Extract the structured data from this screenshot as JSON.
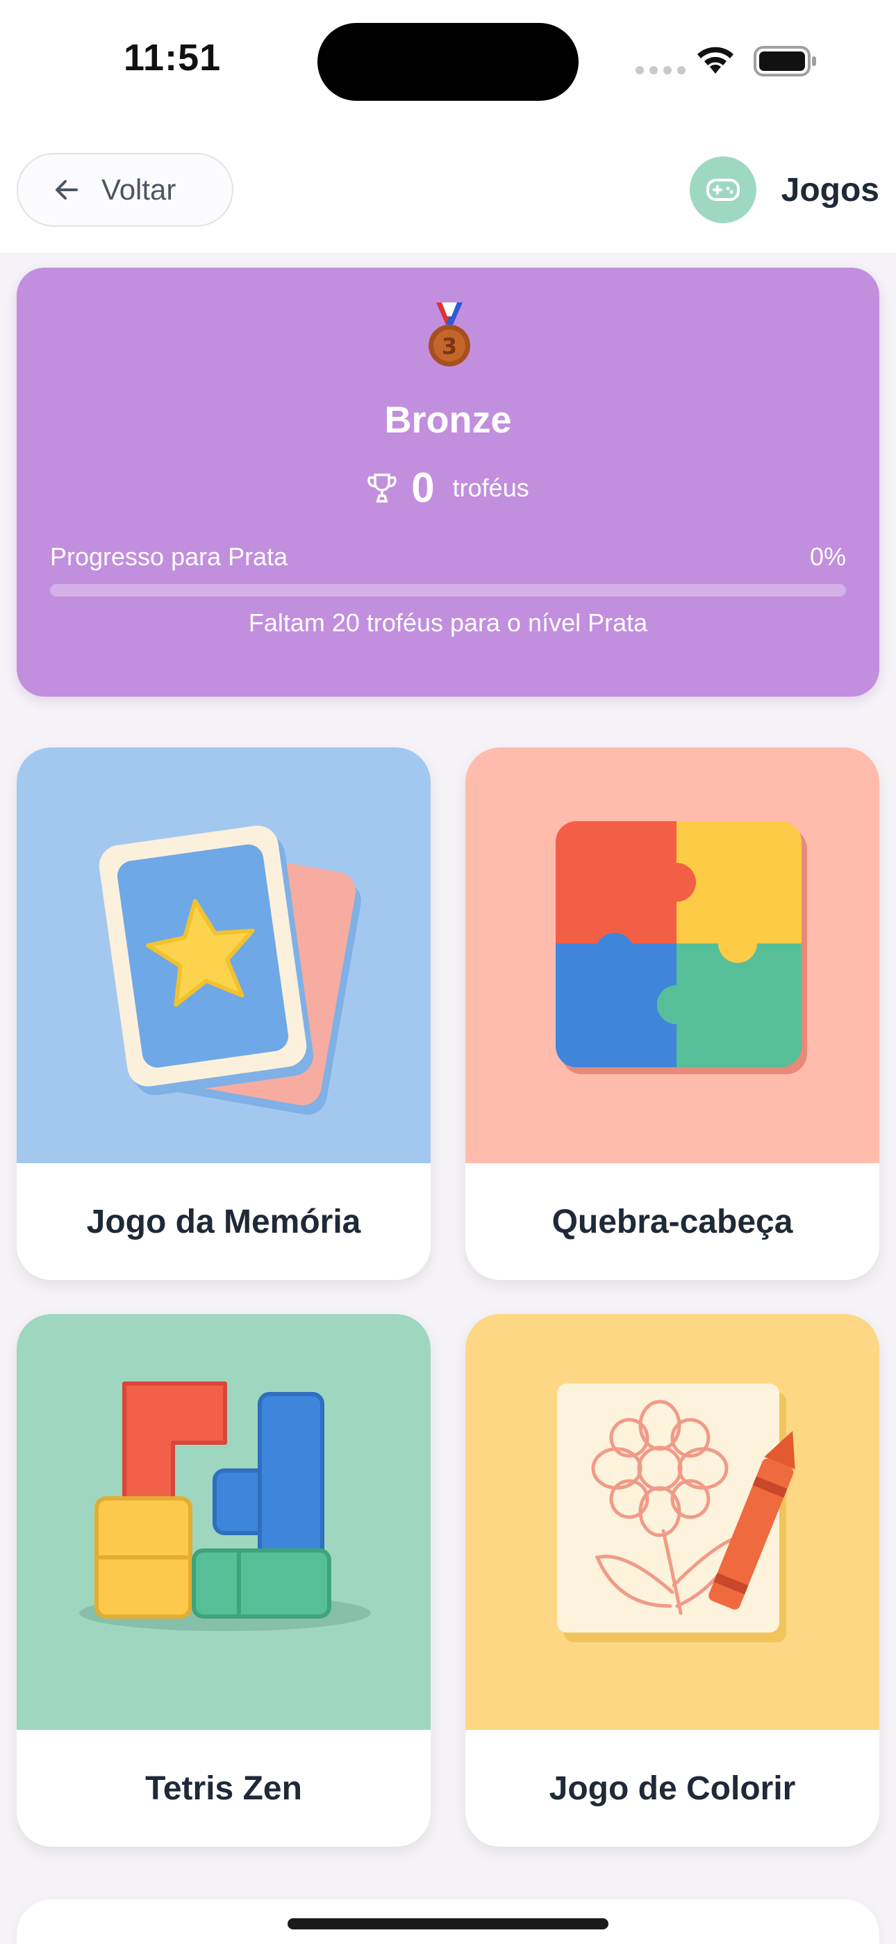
{
  "status": {
    "time": "11:51"
  },
  "header": {
    "back_label": "Voltar",
    "title": "Jogos"
  },
  "level": {
    "name": "Bronze",
    "medal_number": "3",
    "trophies": "0",
    "trophies_label": "troféus",
    "progress_label": "Progresso para Prata",
    "progress_percent": "0%",
    "progress_value": 0,
    "hint": "Faltam 20 troféus para o nível Prata"
  },
  "games": [
    {
      "title": "Jogo da Memória",
      "icon": "memory-cards-icon",
      "color": "#a3c8f0"
    },
    {
      "title": "Quebra-cabeça",
      "icon": "puzzle-icon",
      "color": "#ffbcad"
    },
    {
      "title": "Tetris Zen",
      "icon": "blocks-icon",
      "color": "#9fd6c0"
    },
    {
      "title": "Jogo de Colorir",
      "icon": "coloring-icon",
      "color": "#fdd784"
    }
  ],
  "colors": {
    "level_card": "#c28ede",
    "brand": "#9ed8c2"
  }
}
